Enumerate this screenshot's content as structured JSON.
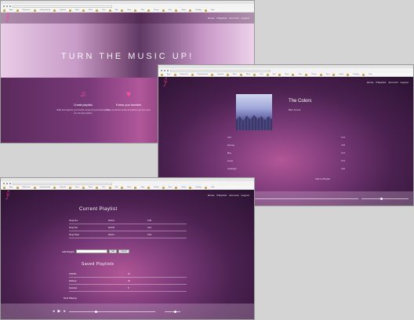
{
  "win1": {
    "bookmarks": [
      "Apps",
      "Bookmarks",
      "Getting Started",
      "Imported",
      "News",
      "Music",
      "Docs",
      "Mail",
      "Maps",
      "Other",
      "Photos",
      "Store",
      "Videos",
      "Reading",
      "Tools"
    ],
    "nav": [
      "Home",
      "Playlists",
      "Account",
      "Logout"
    ],
    "hero_title": "TURN THE MUSIC UP!",
    "features": [
      {
        "icon": "music-note-icon",
        "title": "Create playlists",
        "desc": "Build and organize your favorite songs into personal playlists you can play anytime."
      },
      {
        "icon": "heart-icon",
        "title": "Follow your favorites",
        "desc": "Keep up with the artists and albums you love most."
      }
    ]
  },
  "win2": {
    "nav": [
      "Home",
      "Playlists",
      "Account",
      "Logout"
    ],
    "album_title": "The Colors",
    "album_sub": "Blue Forest",
    "tracks": [
      {
        "name": "Intro",
        "time": "3:12"
      },
      {
        "name": "Morning",
        "time": "4:05"
      },
      {
        "name": "Blue",
        "time": "3:47"
      },
      {
        "name": "Forest",
        "time": "5:01"
      },
      {
        "name": "Goodnight",
        "time": "4:20"
      }
    ],
    "add_label": "Add to Playlist"
  },
  "win3": {
    "bookmarks": [
      "Apps",
      "Bookmarks",
      "Getting Started",
      "Imported",
      "News",
      "Music",
      "Docs",
      "Mail",
      "Maps",
      "Other",
      "Photos",
      "Store",
      "Videos",
      "Reading",
      "Tools"
    ],
    "nav": [
      "Home",
      "Playlists",
      "Account",
      "Logout"
    ],
    "current_title": "Current Playlist",
    "current_rows": [
      [
        "Song One",
        "Artist A",
        "3:45"
      ],
      [
        "Song Two",
        "Artist B",
        "4:10"
      ],
      [
        "Song Three",
        "Artist C",
        "3:02"
      ]
    ],
    "add_label": "Add Playlist",
    "add_btn1": "Add",
    "add_btn2": "Cancel",
    "saved_title": "Saved Playlists",
    "saved_rows": [
      [
        "Chill Mix",
        "12"
      ],
      [
        "Workout",
        "20"
      ],
      [
        "Favorites",
        "8"
      ]
    ],
    "now_playing": "Now Playing"
  },
  "colors": {
    "accent": "#ff3d8e",
    "purple": "#5a2a5c"
  }
}
